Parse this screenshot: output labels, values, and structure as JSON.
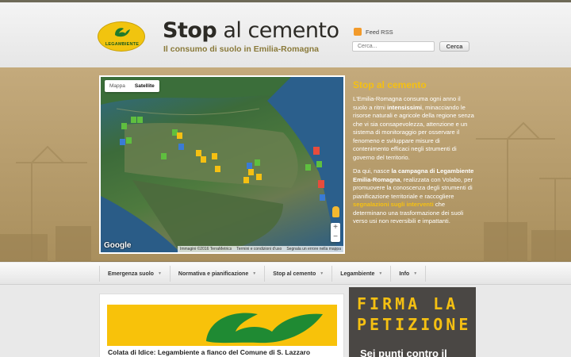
{
  "header": {
    "logo_text": "LEGAMBIENTE",
    "title_part1": "Stop",
    "title_part2": " al cemento",
    "subtitle": "Il consumo di suolo in Emilia-Romagna",
    "rss_label": "Feed RSS",
    "search_placeholder": "Cerca...",
    "search_button": "Cerca"
  },
  "map": {
    "tab_map": "Mappa",
    "tab_satellite": "Satellite",
    "active_tab": "Satellite",
    "zoom_in": "+",
    "zoom_out": "−",
    "google": "Google",
    "attribution": [
      "Immagini ©2016 TerraMetrics",
      "Termini e condizioni d'uso",
      "Segnala un errore nella mappa"
    ]
  },
  "intro": {
    "title": "Stop al cemento",
    "p1_a": "L'Emilia-Romagna consuma ogni anno il suolo a ritmi ",
    "p1_b": "intensissimi",
    "p1_c": ", minacciando le risorse naturali e agricole della regione senza che vi sia consapevolezza, attenzione e un sistema di monitoraggio per osservare il fenomeno e  sviluppare misure di contenimento efficaci negli strumenti di governo del territorio.",
    "p2_a": "Da qui, nasce ",
    "p2_b": "la campagna di Legambiente Emilia-Romagna",
    "p2_c": ", realizzata con Volabo, per promuovere la conoscenza degli strumenti di pianificazione territoriale e raccogliere ",
    "p2_d": "segnalazioni sugli interventi",
    "p2_e": " che determinano una trasformazione dei suoli verso usi non reversibili e impattanti."
  },
  "nav": [
    {
      "label": "Emergenza suolo"
    },
    {
      "label": "Normativa e pianificazione"
    },
    {
      "label": "Stop al cemento"
    },
    {
      "label": "Legambiente"
    },
    {
      "label": "Info"
    }
  ],
  "post": {
    "title": "Colata di Idice: Legambiente a fianco del Comune di S. Lazzaro"
  },
  "sidebar": {
    "petition": "FIRMA LA PETIZIONE",
    "sub": "Sei punti contro il"
  },
  "colors": {
    "accent": "#f5c012",
    "band": "#b89e6c",
    "logo": "#f1c40f"
  }
}
